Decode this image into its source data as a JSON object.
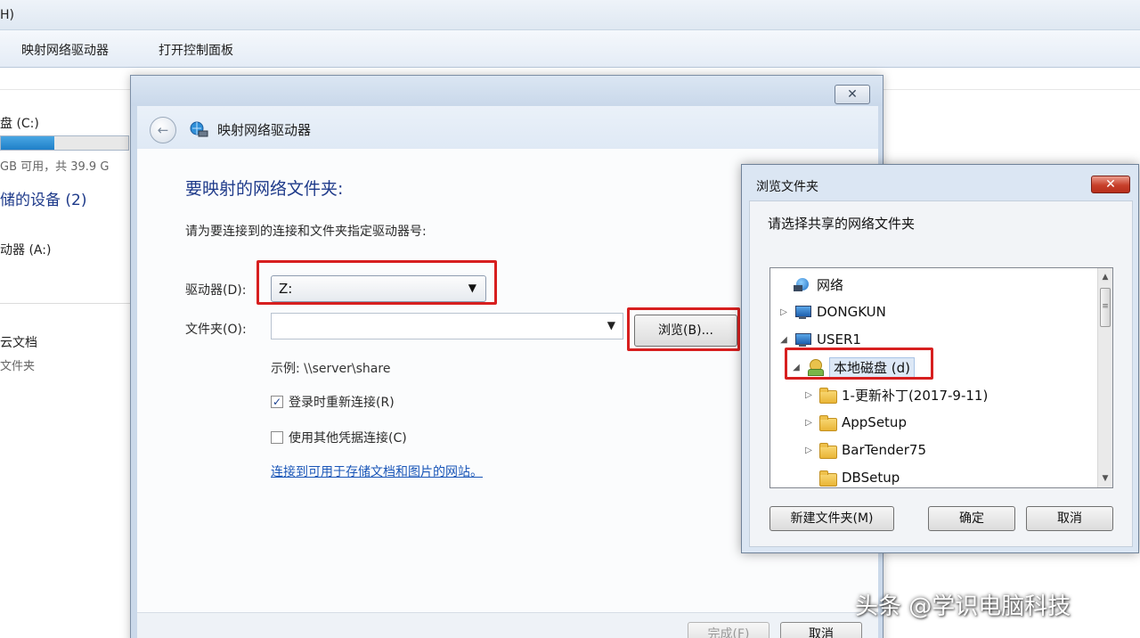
{
  "explorer": {
    "menu_fragment": "H)",
    "toolbar": [
      "映射网络驱动器",
      "打开控制面板"
    ],
    "disk_c_label": "盘 (C:)",
    "disk_c_space": "GB 可用，共 39.9 G",
    "disk_c_used_fraction": 0.42,
    "removable_group": "储的设备 (2)",
    "drive_a": "动器 (A:)",
    "library_title": "云文档",
    "library_sub": "文件夹"
  },
  "wizard": {
    "close_glyph": "✕",
    "back_glyph": "←",
    "title": "映射网络驱动器",
    "heading": "要映射的网络文件夹:",
    "description": "请为要连接到的连接和文件夹指定驱动器号:",
    "drive_label": "驱动器(D):",
    "drive_value": "Z:",
    "folder_label": "文件夹(O):",
    "folder_value": "",
    "browse_label": "浏览(B)...",
    "example": "示例: \\\\server\\share",
    "reconnect_label": "登录时重新连接(R)",
    "reconnect_checked": true,
    "other_creds_label": "使用其他凭据连接(C)",
    "other_creds_checked": false,
    "link": "连接到可用于存储文档和图片的网站。",
    "finish_label": "完成(F)",
    "cancel_label": "取消"
  },
  "browse_dialog": {
    "title": "浏览文件夹",
    "close_glyph": "✕",
    "prompt": "请选择共享的网络文件夹",
    "tree": [
      {
        "label": "网络",
        "icon": "network-icon",
        "arrow": ""
      },
      {
        "label": "DONGKUN",
        "icon": "computer-icon",
        "arrow": "▷"
      },
      {
        "label": "USER1",
        "icon": "computer-icon",
        "arrow": "◢"
      },
      {
        "label": "本地磁盘 (d)",
        "icon": "shared-drive-icon",
        "arrow": "◢",
        "selected": true
      },
      {
        "label": "1-更新补丁(2017-9-11)",
        "icon": "folder-icon",
        "arrow": "▷"
      },
      {
        "label": "AppSetup",
        "icon": "folder-icon",
        "arrow": "▷"
      },
      {
        "label": "BarTender75",
        "icon": "folder-icon",
        "arrow": "▷"
      },
      {
        "label": "DBSetup",
        "icon": "folder-icon",
        "arrow": ""
      }
    ],
    "new_folder_label": "新建文件夹(M)",
    "ok_label": "确定",
    "cancel_label": "取消"
  },
  "watermark": "头条 @学识电脑科技",
  "colors": {
    "highlight": "#d71f1f",
    "heading_blue": "#1e3a8a",
    "link_blue": "#1a56b8"
  }
}
